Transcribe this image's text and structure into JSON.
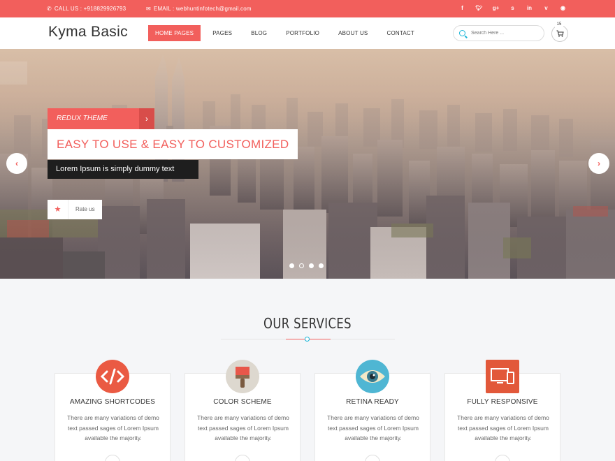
{
  "topbar": {
    "phone_label": "CALL US : +918829926793",
    "email_label": "EMAIL :  webhuntinfotech@gmail.com",
    "social": [
      "f",
      "t",
      "g+",
      "s",
      "in",
      "v",
      "d"
    ]
  },
  "header": {
    "logo": "Kyma Basic",
    "nav": [
      "HOME PAGES",
      "PAGES",
      "BLOG",
      "PORTFOLIO",
      "ABOUT US",
      "CONTACT"
    ],
    "search_placeholder": "Search Here ...",
    "cart_count": "15"
  },
  "hero": {
    "option_label": "REDUX THEME OPTION",
    "option_arrow": "›",
    "headline": "EASY TO USE & EASY TO CUSTOMIZED",
    "subtext": "Lorem Ipsum is simply dummy text",
    "rate_label": "Rate us",
    "prev_icon": "‹",
    "next_icon": "›"
  },
  "services": {
    "title": "OUR SERVICES",
    "cards": [
      {
        "title": "AMAZING SHORTCODES",
        "desc": "There are many variations of demo text passed sages of Lorem Ipsum available the majority."
      },
      {
        "title": "COLOR SCHEME",
        "desc": "There are many variations of demo text passed sages of Lorem Ipsum available the majority."
      },
      {
        "title": "RETINA READY",
        "desc": "There are many variations of demo text passed sages of Lorem Ipsum available the majority."
      },
      {
        "title": "FULLY RESPONSIVE",
        "desc": "There are many variations of demo text passed sages of Lorem Ipsum available the majority."
      }
    ]
  },
  "colors": {
    "accent": "#f25f5c",
    "link": "#19b5d8"
  }
}
